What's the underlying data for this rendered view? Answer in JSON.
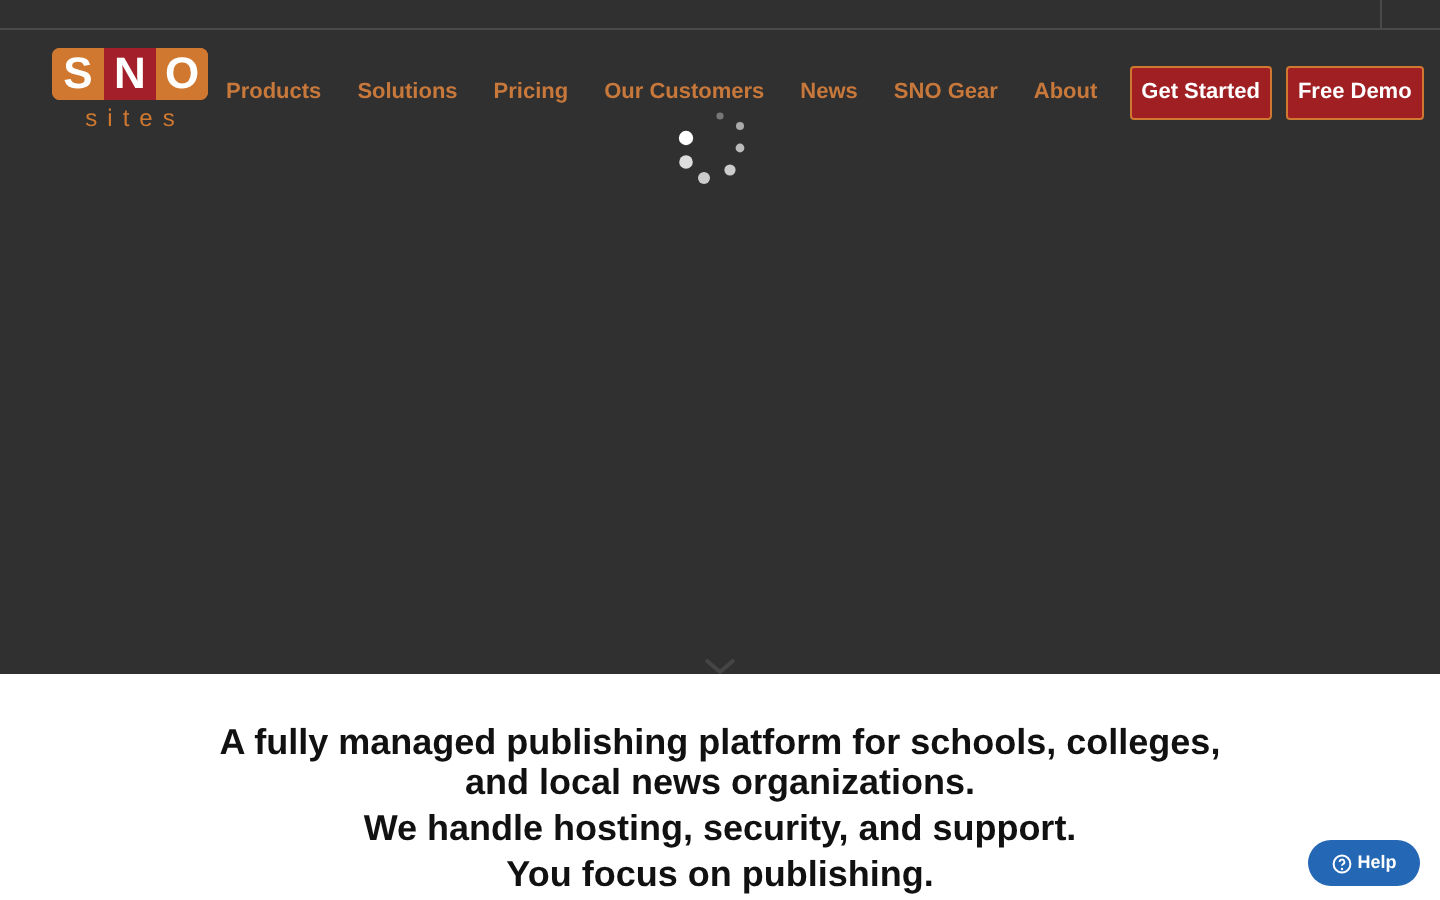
{
  "logo": {
    "letters": [
      "S",
      "N",
      "O"
    ],
    "subtitle": "sites"
  },
  "nav": {
    "links": [
      "Products",
      "Solutions",
      "Pricing",
      "Our Customers",
      "News",
      "SNO Gear",
      "About"
    ],
    "buttons": [
      "Get Started",
      "Free Demo"
    ]
  },
  "intro": [
    "A fully managed publishing platform for schools, colleges, and local news organizations.",
    "We handle hosting, security, and support.",
    "You focus on publishing."
  ],
  "help": {
    "label": "Help"
  }
}
